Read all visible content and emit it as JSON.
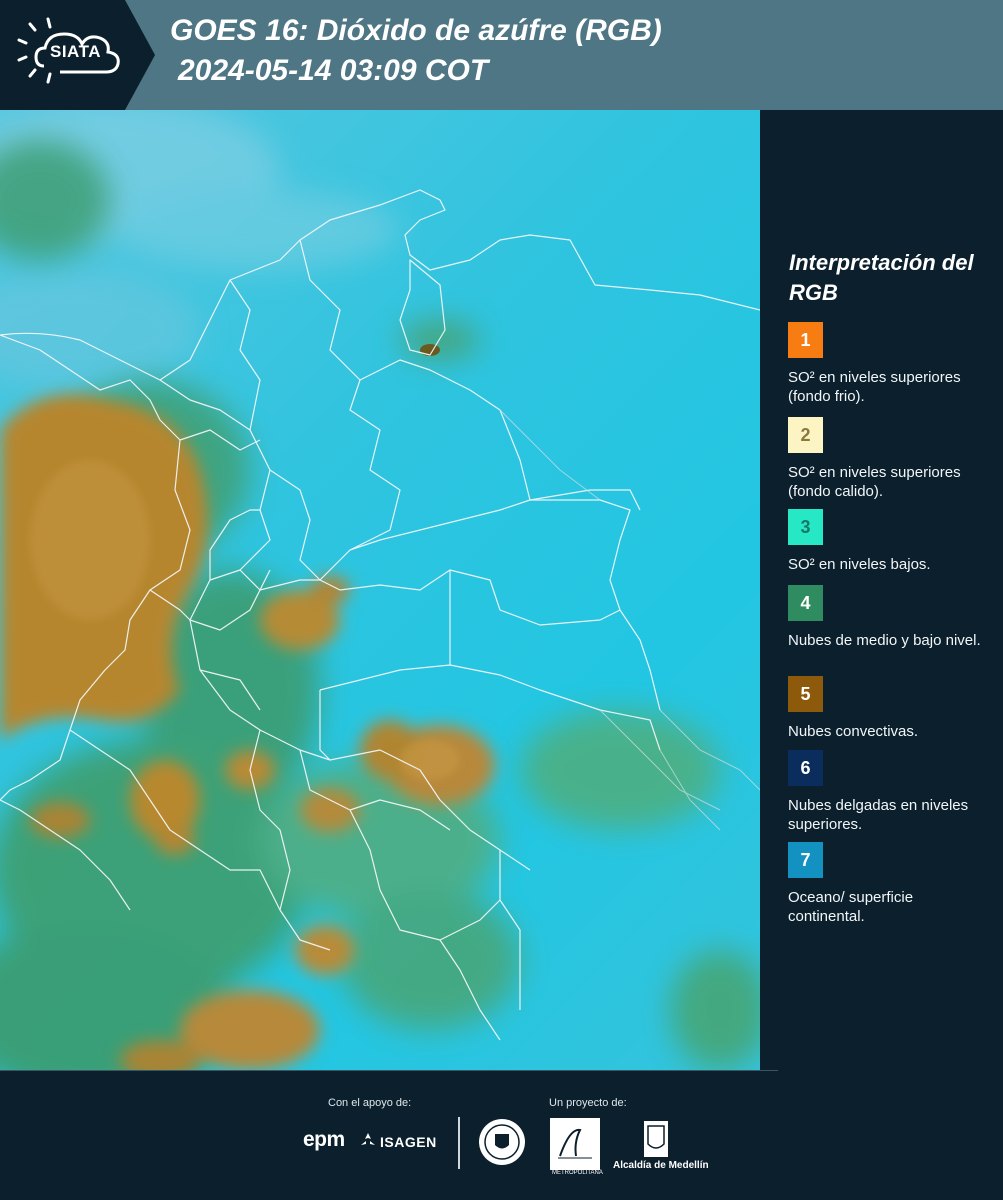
{
  "header": {
    "logo_text": "SIATA",
    "title_line1": "GOES 16: Dióxido de azúfre (RGB)",
    "title_line2": "2024-05-14 03:09 COT"
  },
  "legend": {
    "title": "Interpretación del RGB",
    "items": [
      {
        "number": "1",
        "description": "SO² en niveles superiores (fondo frio).",
        "color": "#f77d12",
        "text_color": "#ffffff"
      },
      {
        "number": "2",
        "description": "SO² en niveles superiores (fondo calido).",
        "color": "#fdf4c4",
        "text_color": "#8a7a40"
      },
      {
        "number": "3",
        "description": "SO² en niveles bajos.",
        "color": "#27e8c5",
        "text_color": "#147a68"
      },
      {
        "number": "4",
        "description": "Nubes de medio y bajo nivel.",
        "color": "#2e8c60",
        "text_color": "#ffffff"
      },
      {
        "number": "5",
        "description": "Nubes convectivas.",
        "color": "#8d5a0b",
        "text_color": "#ffffff"
      },
      {
        "number": "6",
        "description": "Nubes delgadas en niveles superiores.",
        "color": "#0a2d5e",
        "text_color": "#ffffff"
      },
      {
        "number": "7",
        "description": "Oceano/ superficie continental.",
        "color": "#1391c0",
        "text_color": "#ffffff"
      }
    ]
  },
  "footer": {
    "support_label": "Con el apoyo de:",
    "project_label": "Un proyecto de:",
    "sponsor_1": "epm",
    "sponsor_2": "ISAGEN",
    "partner_area": "METROPOLITANA",
    "partner_alcaldia": "Alcaldía de Medellín"
  },
  "colors": {
    "header_bg": "#4e7684",
    "panel_bg": "#0b1f2c",
    "ocean": "#22c6e2",
    "convective": "#b0852a",
    "low_cloud": "#2f9a68"
  }
}
